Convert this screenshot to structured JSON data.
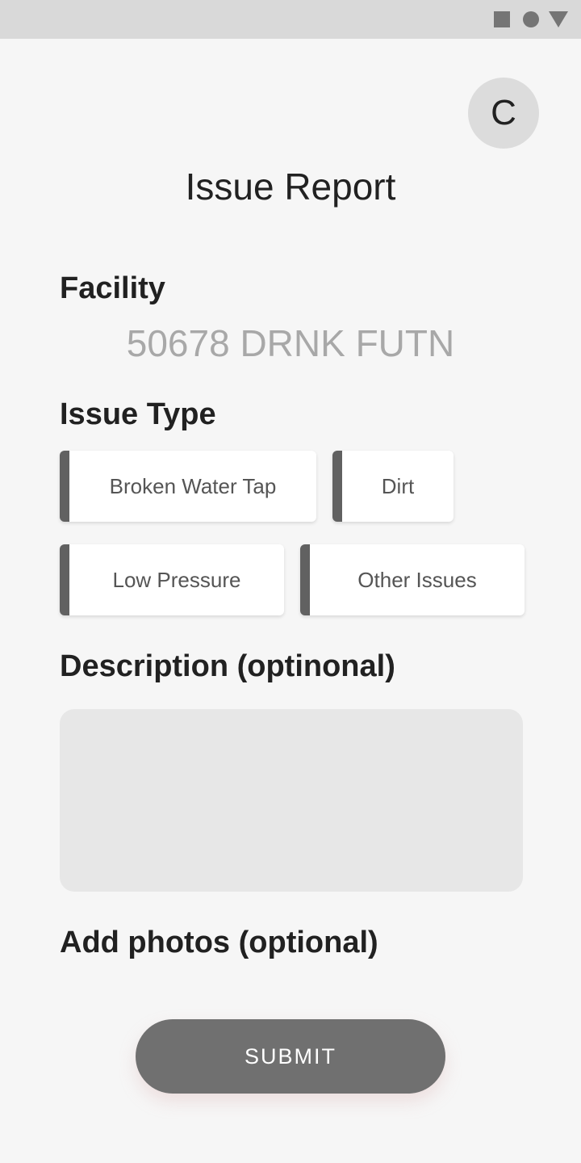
{
  "status_bar": {
    "icons": [
      "square-icon",
      "circle-icon",
      "triangle-icon"
    ]
  },
  "header": {
    "avatar_initial": "C",
    "title": "Issue Report"
  },
  "facility": {
    "label": "Facility",
    "value": "50678 DRNK FUTN"
  },
  "issue_type": {
    "label": "Issue Type",
    "options": [
      "Broken Water Tap",
      "Dirt",
      "Low Pressure",
      "Other Issues"
    ]
  },
  "description": {
    "label": "Description (optinonal)",
    "value": ""
  },
  "photos": {
    "label": "Add photos (optional)"
  },
  "submit": {
    "label": "SUBMIT"
  },
  "colors": {
    "background": "#f6f6f6",
    "status_bar": "#d9d9d9",
    "chip_accent": "#616161",
    "submit_bg": "#707070",
    "placeholder_text": "#a8a8a8"
  }
}
